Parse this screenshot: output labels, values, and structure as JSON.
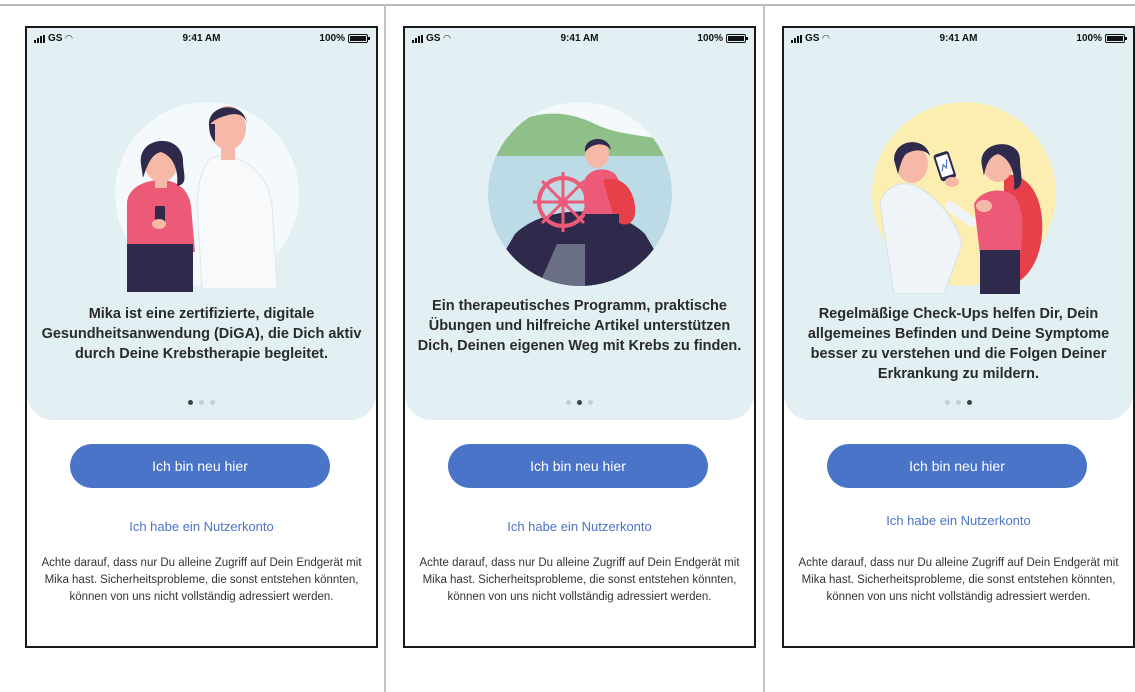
{
  "status_bar": {
    "carrier": "GS",
    "time": "9:41 AM",
    "battery": "100%"
  },
  "screens": [
    {
      "caption": "Mika ist eine zertifizierte, digitale Gesundheitsanwendung (DiGA), die Dich aktiv durch Deine Krebstherapie begleitet.",
      "active_dot": 1,
      "illustration": "patient-and-doctor-illustration"
    },
    {
      "caption": "Ein therapeutisches Programm, praktische Übungen und hilfreiche Artikel unterstützen Dich, Deinen eigenen Weg mit Krebs zu finden.",
      "active_dot": 2,
      "illustration": "person-steering-ship-illustration"
    },
    {
      "caption": "Regelmäßige Check-Ups helfen Dir, Dein allgemeines Befinden und Deine Symptome besser zu verstehen und die Folgen Deiner Erkrankung zu mildern.",
      "active_dot": 3,
      "illustration": "doctor-and-patient-phone-illustration"
    }
  ],
  "buttons": {
    "new_user": "Ich bin neu hier",
    "has_account": "Ich habe ein Nutzerkonto"
  },
  "security_note": "Achte darauf, dass nur Du alleine Zugriff auf Dein Endgerät mit Mika hast. Sicherheitsprobleme, die sonst entstehen könnten, können von uns nicht vollständig adressiert werden.",
  "colors": {
    "accent": "#4a74c8",
    "panel": "#e2eff3",
    "pink": "#ec5a78",
    "navy": "#2f2a4c"
  }
}
